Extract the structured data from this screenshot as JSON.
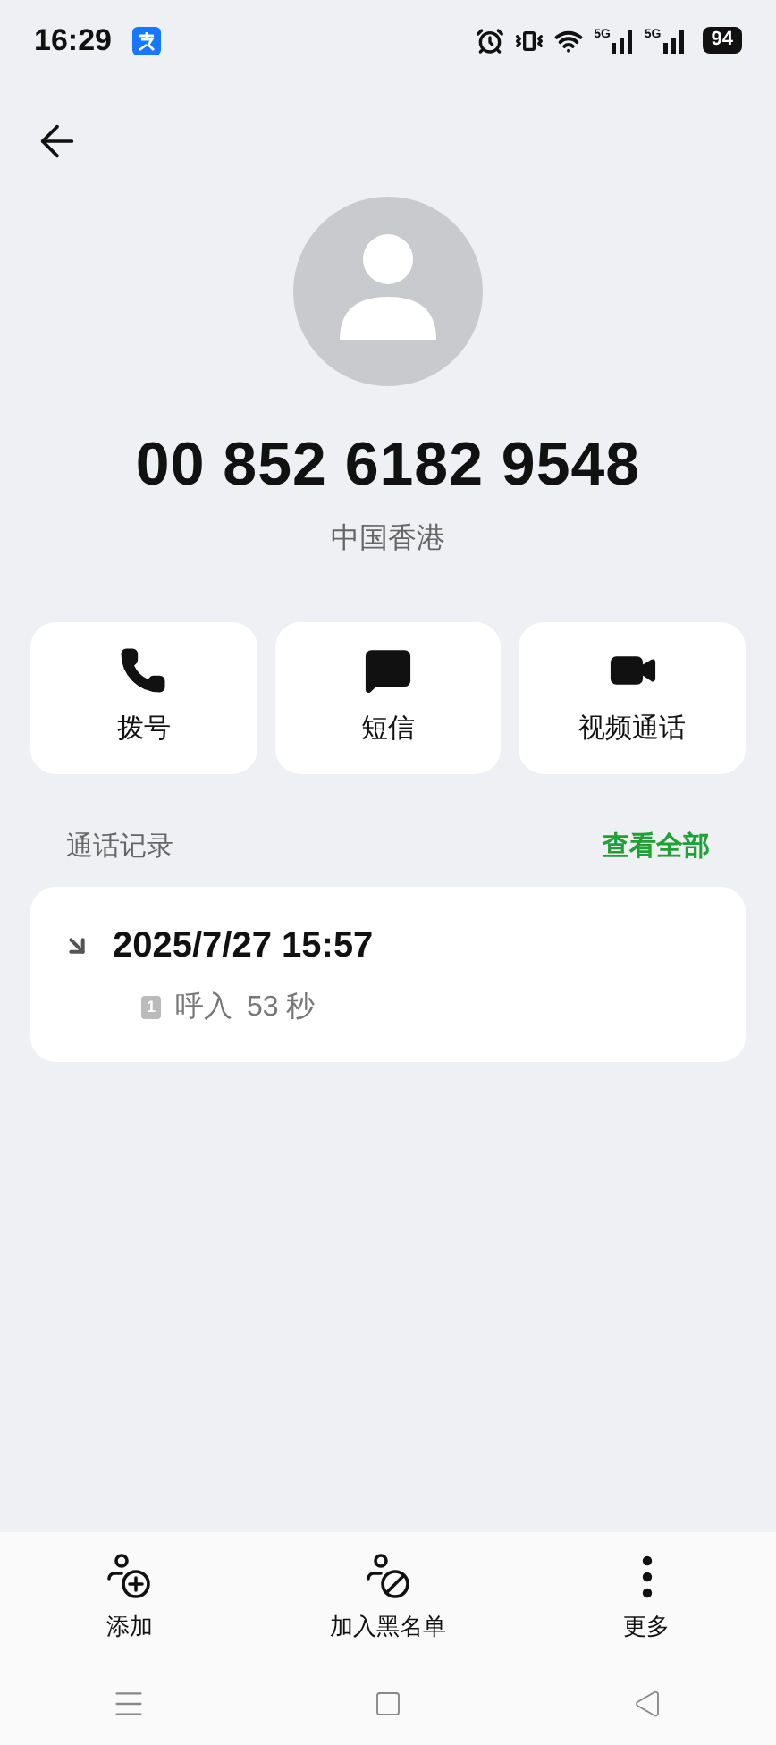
{
  "status_bar": {
    "time": "16:29",
    "network_labels": [
      "5G",
      "5G"
    ],
    "battery": "94"
  },
  "contact": {
    "number": "00 852 6182 9548",
    "region": "中国香港"
  },
  "actions": [
    {
      "kind": "call",
      "label": "拨号"
    },
    {
      "kind": "message",
      "label": "短信"
    },
    {
      "kind": "video",
      "label": "视频通话"
    }
  ],
  "call_history": {
    "title": "通话记录",
    "view_all": "查看全部",
    "entries": [
      {
        "incoming": true,
        "time": "2025/7/27 15:57",
        "sim": "1",
        "type": "呼入",
        "duration": "53 秒"
      }
    ]
  },
  "bottom_actions": [
    {
      "kind": "add",
      "label": "添加"
    },
    {
      "kind": "block",
      "label": "加入黑名单"
    },
    {
      "kind": "more",
      "label": "更多"
    }
  ]
}
